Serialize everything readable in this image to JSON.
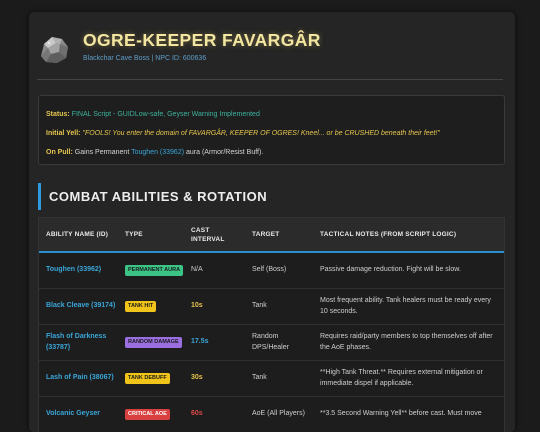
{
  "header": {
    "title": "OGRE-KEEPER FAVARGÂR",
    "subtitle": "Blackchar Cave Boss | NPC ID: 600636",
    "icon": "ore-rock-icon"
  },
  "info": {
    "status_label": "Status:",
    "status_value": "FINAL Script - GUIDLow-safe, Geyser Warning Implemented",
    "yell_label": "Initial Yell:",
    "yell_value": "\"FOOLS! You enter the domain of FAVARGÂR, KEEPER OF OGRES! Kneel... or be CRUSHED beneath their feet!\"",
    "pull_label": "On Pull:",
    "pull_prefix": "Gains Permanent",
    "pull_link": "Toughen (33962)",
    "pull_suffix": "aura (Armor/Resist Buff)."
  },
  "section": {
    "title": "COMBAT ABILITIES & ROTATION"
  },
  "table": {
    "headers": [
      "ABILITY NAME (ID)",
      "TYPE",
      "CAST INTERVAL",
      "TARGET",
      "TACTICAL NOTES (FROM SCRIPT LOGIC)"
    ],
    "rows": [
      {
        "name": "Toughen (33962)",
        "type": "PERMANENT AURA",
        "type_color": "#3cc486",
        "cast": "N/A",
        "target": "Self (Boss)",
        "notes": "Passive damage reduction. Fight will be slow."
      },
      {
        "name": "Black Cleave (39174)",
        "type": "TANK HIT",
        "type_color": "#f0c419",
        "cast": "10s",
        "target": "Tank",
        "notes": "Most frequent ability. Tank healers must be ready every 10 seconds."
      },
      {
        "name": "Flash of Darkness (33787)",
        "type": "RANDOM DAMAGE",
        "type_color": "#9b6fe0",
        "cast": "17.5s",
        "target": "Random DPS/Healer",
        "notes": "Requires raid/party members to top themselves off after the AoE phases."
      },
      {
        "name": "Lash of Pain (38067)",
        "type": "TANK DEBUFF",
        "type_color": "#f0c419",
        "cast": "30s",
        "target": "Tank",
        "notes": "**High Tank Threat.** Requires external mitigation or immediate dispel if applicable."
      },
      {
        "name": "Volcanic Geyser",
        "type": "CRITICAL AOE",
        "type_color": "#d94141",
        "cast": "60s",
        "target": "AoE (All Players)",
        "notes": "**3.5 Second Warning Yell** before cast. Must move"
      }
    ]
  }
}
